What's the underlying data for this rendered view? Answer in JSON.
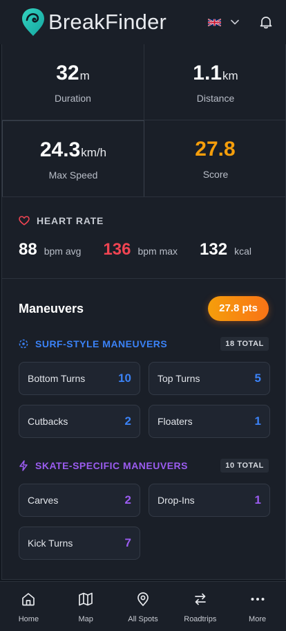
{
  "header": {
    "brand": "BreakFinder",
    "language_icon": "uk-flag-icon",
    "notifications_icon": "bell-icon"
  },
  "stats": [
    {
      "value": "32",
      "unit": "m",
      "label": "Duration"
    },
    {
      "value": "1.1",
      "unit": "km",
      "label": "Distance"
    },
    {
      "value": "24.3",
      "unit": "km/h",
      "label": "Max Speed"
    },
    {
      "value": "27.8",
      "unit": "",
      "label": "Score"
    }
  ],
  "heart_rate": {
    "title": "HEART RATE",
    "avg_value": "88",
    "avg_unit": "bpm avg",
    "max_value": "136",
    "max_unit": "bpm max",
    "kcal_value": "132",
    "kcal_unit": "kcal"
  },
  "maneuvers": {
    "title": "Maneuvers",
    "points": "27.8 pts",
    "categories": [
      {
        "name": "SURF-STYLE MANEUVERS",
        "total": "18 TOTAL",
        "items": [
          {
            "label": "Bottom Turns",
            "count": "10"
          },
          {
            "label": "Top Turns",
            "count": "5"
          },
          {
            "label": "Cutbacks",
            "count": "2"
          },
          {
            "label": "Floaters",
            "count": "1"
          }
        ]
      },
      {
        "name": "SKATE-SPECIFIC MANEUVERS",
        "total": "10 TOTAL",
        "items": [
          {
            "label": "Carves",
            "count": "2"
          },
          {
            "label": "Drop-Ins",
            "count": "1"
          },
          {
            "label": "Kick Turns",
            "count": "7"
          }
        ]
      }
    ]
  },
  "nav": [
    {
      "label": "Home",
      "icon": "home-icon"
    },
    {
      "label": "Map",
      "icon": "map-icon"
    },
    {
      "label": "All Spots",
      "icon": "location-pin-icon"
    },
    {
      "label": "Roadtrips",
      "icon": "arrows-exchange-icon"
    },
    {
      "label": "More",
      "icon": "more-dots-icon"
    }
  ],
  "colors": {
    "background": "#131820",
    "surface": "#1a1f28",
    "score_orange": "#f59e0b",
    "heart_red": "#ef4452",
    "surf_blue": "#3b82f6",
    "skate_purple": "#9b5cf0"
  }
}
